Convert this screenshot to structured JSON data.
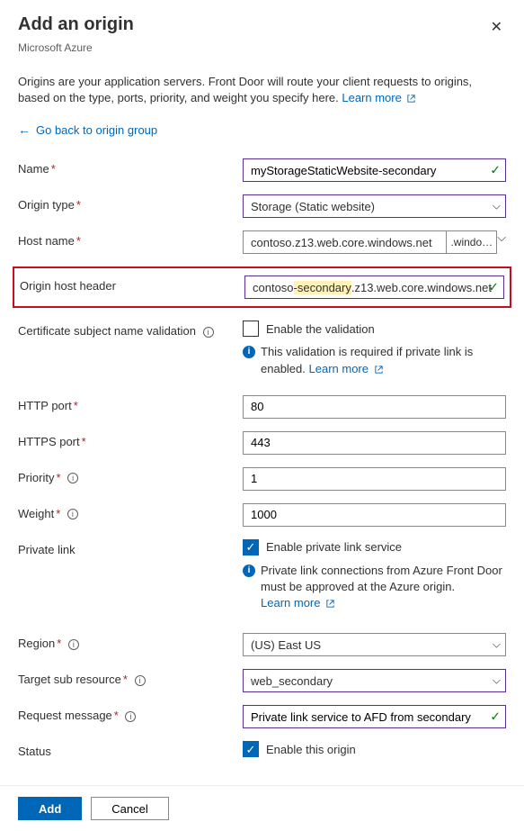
{
  "header": {
    "title": "Add an origin",
    "subtitle": "Microsoft Azure"
  },
  "intro": {
    "text": "Origins are your application servers. Front Door will route your client requests to origins, based on the type, ports, priority, and weight you specify here. ",
    "learn_more": "Learn more"
  },
  "back_link": "Go back to origin group",
  "fields": {
    "name": {
      "label": "Name",
      "value": "myStorageStaticWebsite-secondary"
    },
    "origin_type": {
      "label": "Origin type",
      "value": "Storage (Static website)"
    },
    "host_name": {
      "label": "Host name",
      "value": "contoso.z13.web.core.windows.net",
      "pill": ".windo…"
    },
    "origin_host_header": {
      "label": "Origin host header",
      "prefix": "contoso",
      "highlight": "-secondary",
      "suffix": ".z13.web.core.windows.net"
    },
    "cert_validation": {
      "label": "Certificate subject name validation",
      "checkbox_label": "Enable the validation",
      "note": "This validation is required if private link is enabled. ",
      "learn_more": "Learn more"
    },
    "http_port": {
      "label": "HTTP port",
      "value": "80"
    },
    "https_port": {
      "label": "HTTPS port",
      "value": "443"
    },
    "priority": {
      "label": "Priority",
      "value": "1"
    },
    "weight": {
      "label": "Weight",
      "value": "1000"
    },
    "private_link": {
      "label": "Private link",
      "checkbox_label": "Enable private link service",
      "note": "Private link connections from Azure Front Door must be approved at the Azure origin. ",
      "learn_more": "Learn more"
    },
    "region": {
      "label": "Region",
      "value": "(US) East US"
    },
    "target_sub_resource": {
      "label": "Target sub resource",
      "value": "web_secondary"
    },
    "request_message": {
      "label": "Request message",
      "value": "Private link service to AFD from secondary"
    },
    "status": {
      "label": "Status",
      "checkbox_label": "Enable this origin"
    }
  },
  "footer": {
    "add": "Add",
    "cancel": "Cancel"
  }
}
